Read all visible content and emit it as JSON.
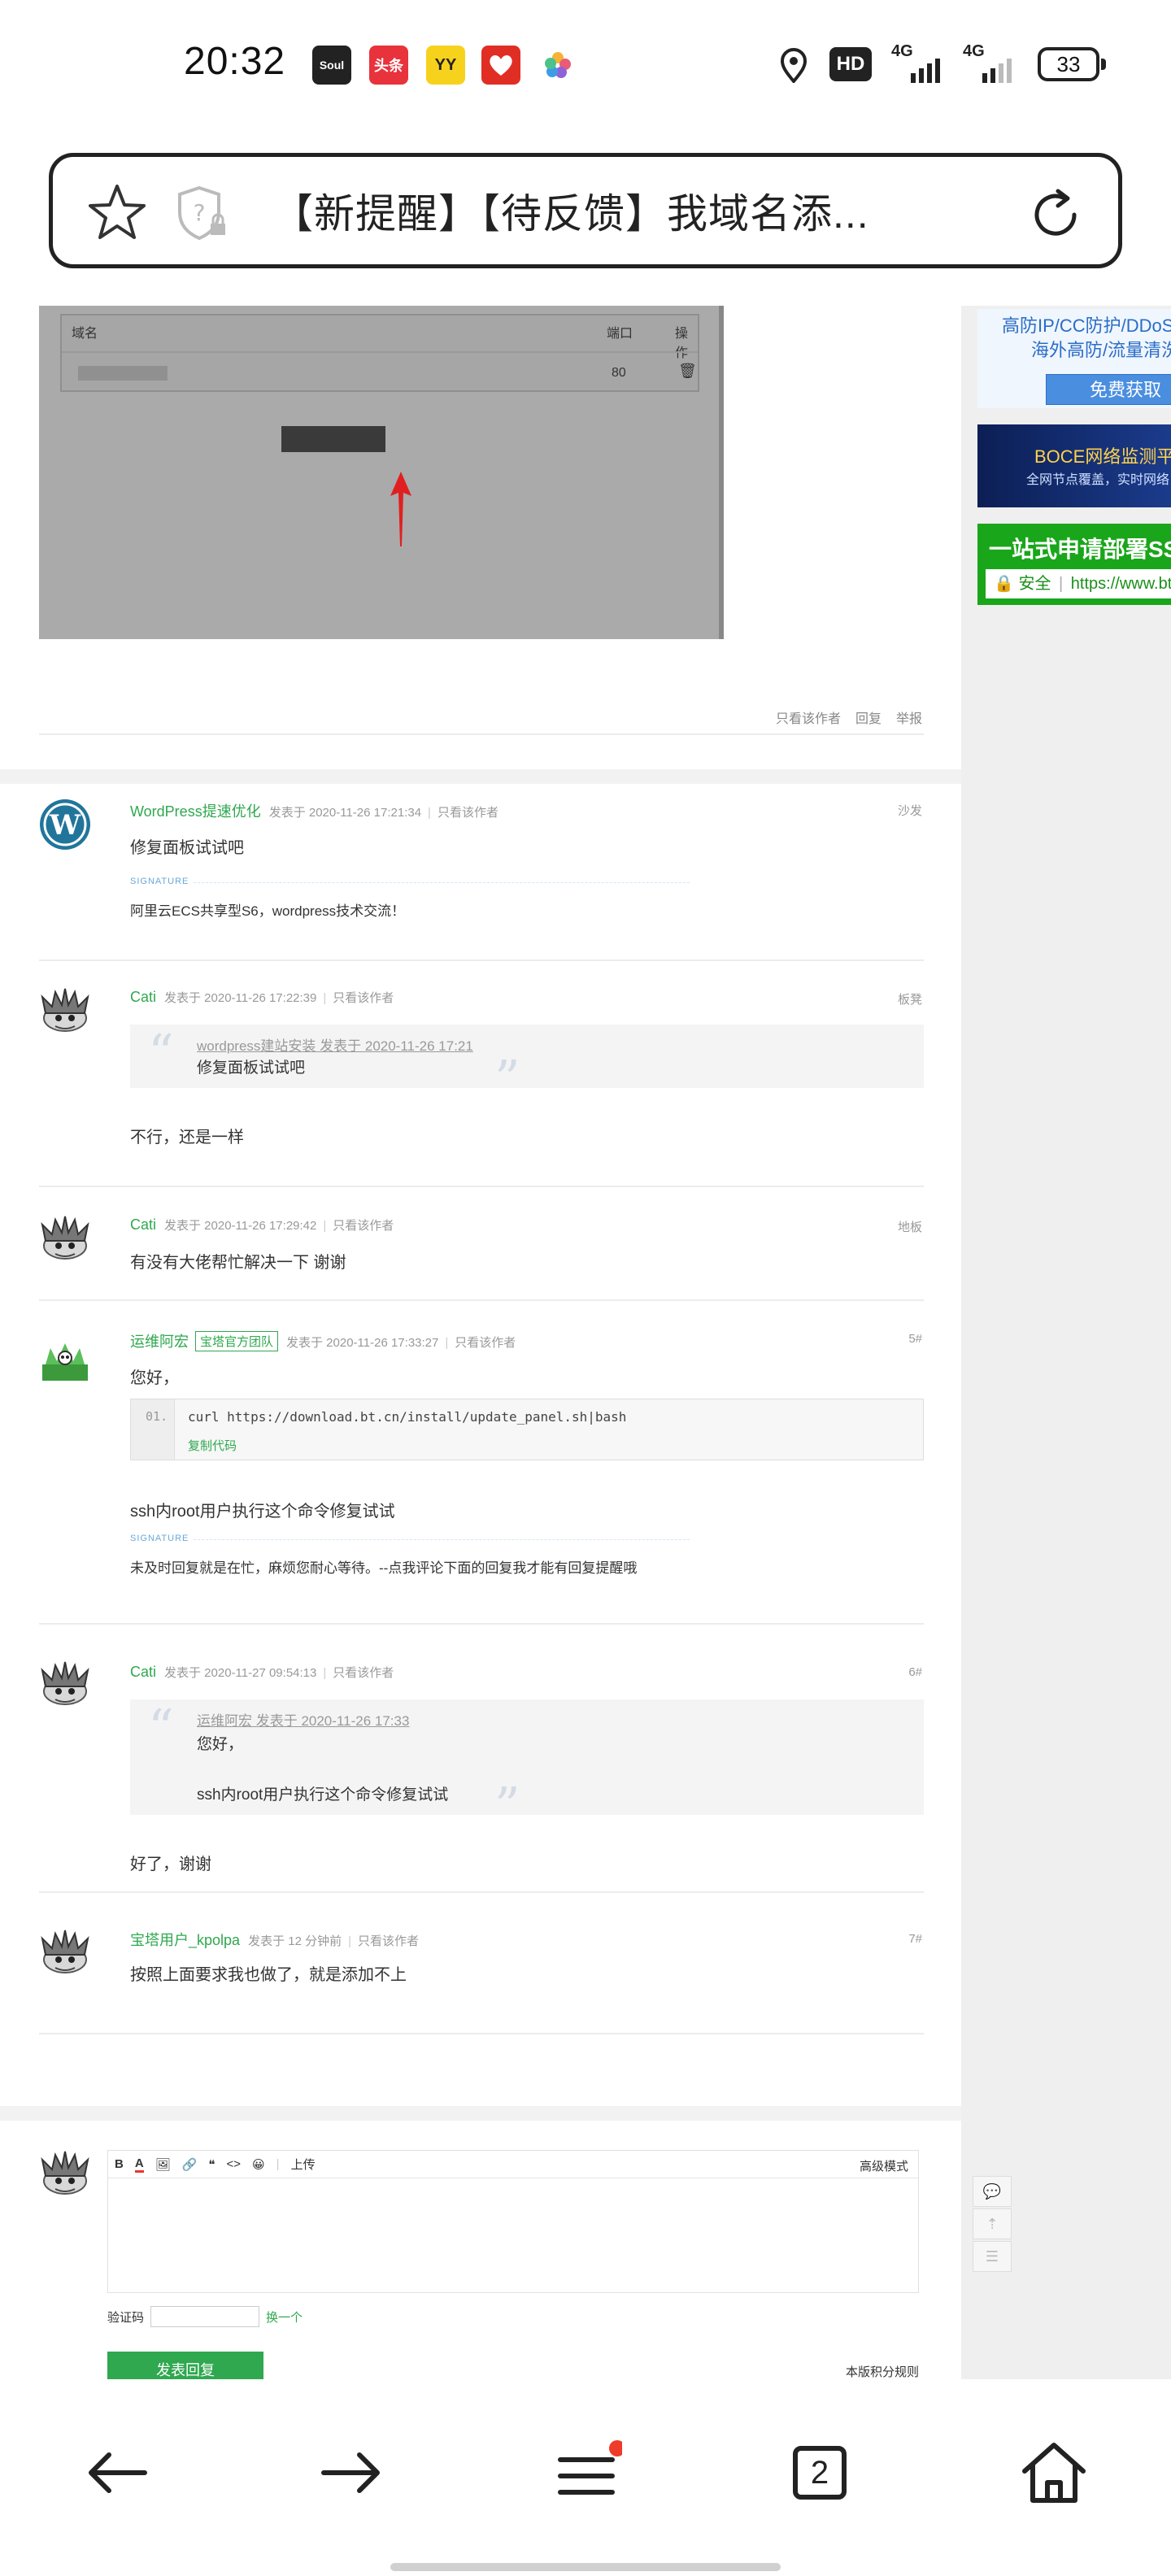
{
  "status_bar": {
    "time": "20:32",
    "apps": [
      {
        "name": "soul-app-icon",
        "label": "Soul",
        "color": "#222222"
      },
      {
        "name": "toutiao-app-icon",
        "label": "头条",
        "color": "#e8323c"
      },
      {
        "name": "yy-app-icon",
        "label": "YY",
        "color": "#f7d21c"
      },
      {
        "name": "pinduoduo-app-icon",
        "label": "",
        "color": "#e02e24"
      },
      {
        "name": "photos-app-icon",
        "label": "",
        "color": "#b06ce0"
      }
    ],
    "hd_label": "HD",
    "net_1": "4G",
    "net_2": "4G",
    "battery": "33"
  },
  "url_bar": {
    "title": "【新提醒】【待反馈】我域名添..."
  },
  "sidebar_ads": {
    "ad1_line1": "高防IP/CC防护/DDoS",
    "ad1_line2": "海外高防/流量清洗",
    "ad1_button": "免费获取",
    "ad2_line1": "BOCE网络监测平台",
    "ad2_line2": "全网节点覆盖，实时网络",
    "ad3_line1": "一站式申请部署SSL",
    "ad3_secure": "安全",
    "ad3_url": "https://www.bt"
  },
  "first_post": {
    "screenshot": {
      "col_domain": "域名",
      "col_port": "端口",
      "col_action": "操作",
      "port_value": "80"
    },
    "actions": [
      "只看该作者",
      "回复",
      "举报"
    ]
  },
  "posts": [
    {
      "author": "WordPress提速优化",
      "time": "发表于 2020-11-26 17:21:34",
      "only": "只看该作者",
      "floor": "沙发",
      "text": "修复面板试试吧",
      "sig_label": "SIGNATURE",
      "signature": "阿里云ECS共享型S6，wordpress技术交流！"
    },
    {
      "author": "Cati",
      "time": "发表于 2020-11-26 17:22:39",
      "only": "只看该作者",
      "floor": "板凳",
      "quote_src": "wordpress建站安装 发表于 2020-11-26 17:21",
      "quote_text": "修复面板试试吧",
      "text": "不行，还是一样"
    },
    {
      "author": "Cati",
      "time": "发表于 2020-11-26 17:29:42",
      "only": "只看该作者",
      "floor": "地板",
      "text": "有没有大佬帮忙解决一下 谢谢"
    },
    {
      "author": "运维阿宏",
      "badge": "宝塔官方团队",
      "time": "发表于 2020-11-26 17:33:27",
      "only": "只看该作者",
      "floor": "5#",
      "text": "您好，",
      "code_num": "01.",
      "code": "curl https://download.bt.cn/install/update_panel.sh|bash",
      "code_copy": "复制代码",
      "text2": "ssh内root用户执行这个命令修复试试",
      "sig_label": "SIGNATURE",
      "signature": "未及时回复就是在忙，麻烦您耐心等待。--点我评论下面的回复我才能有回复提醒哦"
    },
    {
      "author": "Cati",
      "time": "发表于 2020-11-27 09:54:13",
      "only": "只看该作者",
      "floor": "6#",
      "quote_src": "运维阿宏 发表于 2020-11-26 17:33",
      "quote_text": "您好，",
      "quote_text2": "ssh内root用户执行这个命令修复试试",
      "text": "好了，谢谢"
    },
    {
      "author": "宝塔用户_kpolpa",
      "time": "发表于 12 分钟前",
      "only": "只看该作者",
      "floor": "7#",
      "text": "按照上面要求我也做了，就是添加不上"
    }
  ],
  "reply_box": {
    "tools": [
      "B",
      "A",
      "上传"
    ],
    "advanced": "高级模式",
    "captcha_label": "验证码",
    "captcha_refresh": "换一个",
    "submit": "发表回复",
    "rules": "本版积分规则"
  },
  "bottom_nav": {
    "tab_count": "2"
  }
}
